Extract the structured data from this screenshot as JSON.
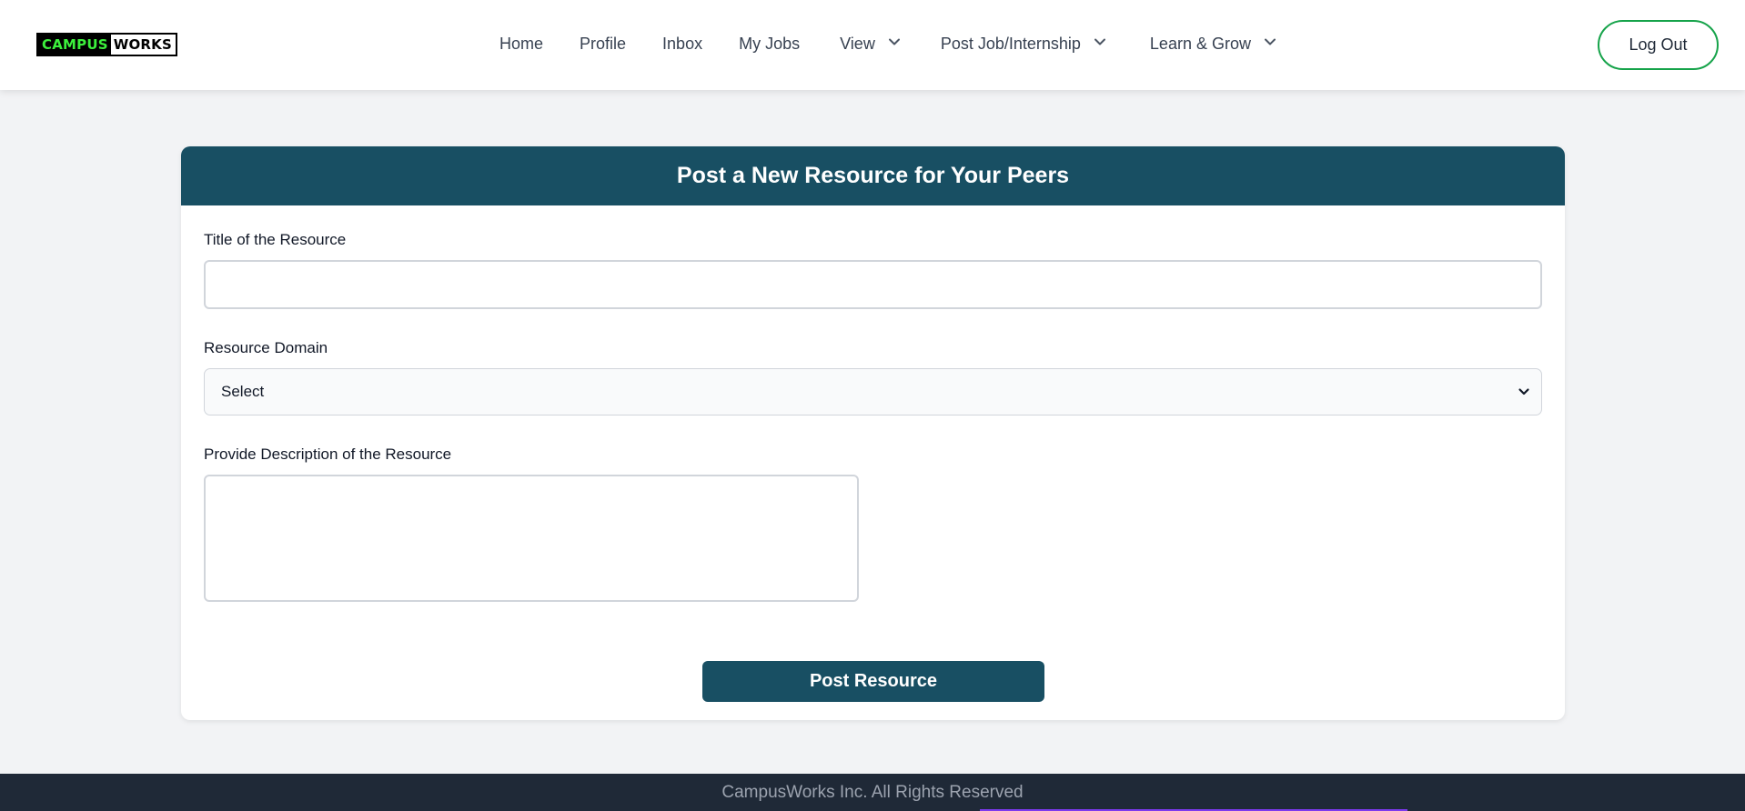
{
  "brand": {
    "part1": "CAMPUS",
    "part2": "WORKS"
  },
  "nav": {
    "items": [
      {
        "label": "Home",
        "dropdown": false
      },
      {
        "label": "Profile",
        "dropdown": false
      },
      {
        "label": "Inbox",
        "dropdown": false
      },
      {
        "label": "My Jobs",
        "dropdown": false
      },
      {
        "label": "View",
        "dropdown": true
      },
      {
        "label": "Post Job/Internship",
        "dropdown": true
      },
      {
        "label": "Learn & Grow",
        "dropdown": true
      }
    ],
    "logout_label": "Log Out",
    "icon": "chevron-down-icon"
  },
  "form": {
    "heading": "Post a New Resource for Your Peers",
    "title_label": "Title of the Resource",
    "title_value": "",
    "domain_label": "Resource Domain",
    "domain_selected": "Select",
    "description_label": "Provide Description of the Resource",
    "description_value": "",
    "submit_label": "Post Resource"
  },
  "footer": {
    "text": "CampusWorks Inc. All Rights Reserved"
  },
  "colors": {
    "primary": "#184f63",
    "logout_border": "#16a34a",
    "logo_green": "#3cf03c",
    "footer_bg": "#1f2937",
    "page_bg": "#f2f3f5"
  }
}
